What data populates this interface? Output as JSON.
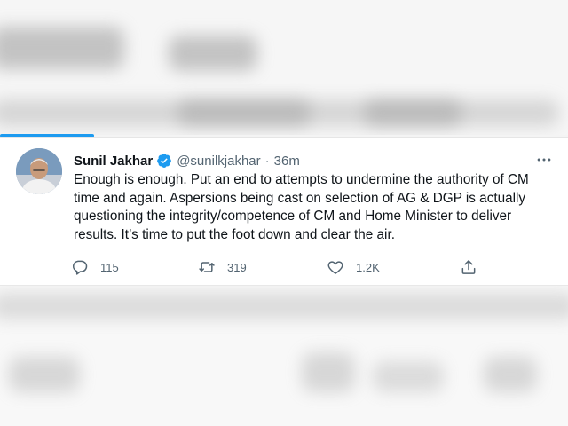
{
  "tweet": {
    "author_name": "Sunil Jakhar",
    "handle": "@sunilkjakhar",
    "separator": "·",
    "time": "36m",
    "text": "Enough is enough. Put an end to attempts to undermine the authority of CM time and again. Aspersions being cast on selection of AG & DGP is actually questioning the integrity/competence of CM and Home Minister to deliver results. It’s time to put the foot down and clear the air.",
    "actions": {
      "reply_count": "115",
      "retweet_count": "319",
      "like_count": "1.2K"
    }
  },
  "icons": {
    "verified": "verified-badge-icon",
    "more": "more-options-icon",
    "reply": "reply-icon",
    "retweet": "retweet-icon",
    "like": "heart-icon",
    "share": "share-icon"
  },
  "colors": {
    "accent": "#1d9bf0",
    "text": "#0f1419",
    "muted": "#536471"
  }
}
